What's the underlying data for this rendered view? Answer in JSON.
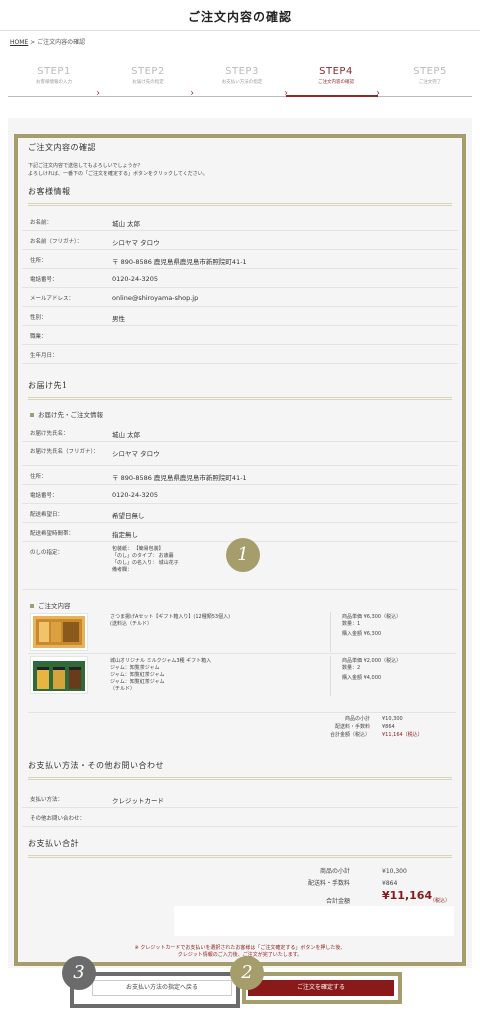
{
  "page_title": "ご注文内容の確認",
  "breadcrumb": {
    "home": "HOME",
    "sep": ">",
    "current": "ご注文内容の確認"
  },
  "steps": [
    {
      "num": "STEP1",
      "label": "お客様情報の入力"
    },
    {
      "num": "STEP2",
      "label": "お届け先の指定"
    },
    {
      "num": "STEP3",
      "label": "お支払い方法の指定"
    },
    {
      "num": "STEP4",
      "label": "ご注文内容の確認"
    },
    {
      "num": "STEP5",
      "label": "ご注文完了"
    }
  ],
  "confirm": {
    "heading": "ご注文内容の確認",
    "intro1": "下記ご注文内容で送信してもよろしいでしょうか？",
    "intro2": "よろしければ、一番下の「ご注文を確定する」ボタンをクリックしてください。"
  },
  "customer": {
    "heading": "お客様情報",
    "rows": [
      {
        "k": "お名前：",
        "v": "城山 太郎"
      },
      {
        "k": "お名前（フリガナ）：",
        "v": "シロヤマ タロウ"
      },
      {
        "k": "住所：",
        "v": "〒 890-8586 鹿児島県鹿児島市新照院町41-1"
      },
      {
        "k": "電話番号：",
        "v": "0120-24-3205"
      },
      {
        "k": "メールアドレス：",
        "v": "online@shiroyama-shop.jp"
      },
      {
        "k": "性別：",
        "v": "男性"
      },
      {
        "k": "職業：",
        "v": ""
      },
      {
        "k": "生年月日：",
        "v": ""
      }
    ]
  },
  "delivery": {
    "heading": "お届け先1",
    "sub": "お届け先・ご注文情報",
    "rows": [
      {
        "k": "お届け先氏名：",
        "v": "城山 太郎"
      },
      {
        "k": "お届け先氏名（フリガナ）：",
        "v": "シロヤマ タロウ"
      },
      {
        "k": "住所：",
        "v": "〒 890-8586 鹿児島県鹿児島市新照院町41-1"
      },
      {
        "k": "電話番号：",
        "v": "0120-24-3205"
      },
      {
        "k": "配送希望日：",
        "v": "希望日無し"
      },
      {
        "k": "配送希望時間帯：",
        "v": "指定無し"
      }
    ],
    "noshi_key": "のしの指定：",
    "noshi_lines": [
      "包装紙： 【簡易包装】",
      "「のし」のタイプ： お歳暮",
      "「のし」の名入り： 城山花子",
      "備考欄："
    ]
  },
  "order": {
    "sub": "ご注文内容",
    "items": [
      {
        "name": "さつま揚げAセット【ギフト箱入り】(12種類53個入)",
        "note": "(送料込（チルド）",
        "price": "商品単価 ¥6,300（税込）",
        "qty": "数量：1",
        "amount": "購入金額 ¥6,300"
      },
      {
        "name": "城山オリジナル ミルクジャム3種 ギフト箱入",
        "note1": "ジャム：知覧茶ジャム",
        "note2": "ジャム：知覧紅茶ジャム",
        "note3": "ジャム：知覧紅茶ジャム",
        "note4": "（チルド）",
        "price": "商品単価 ¥2,000（税込）",
        "qty": "数量：2",
        "amount": "購入金額 ¥4,000"
      }
    ],
    "subtotal_label": "商品の小計",
    "subtotal": "¥10,300",
    "shipping_label": "配送料・手数料",
    "shipping": "¥864",
    "total_label": "合計金額（税込）",
    "total": "¥11,164（税込）"
  },
  "payment": {
    "heading": "お支払い方法・その他お問い合わせ",
    "rows": [
      {
        "k": "支払い方法：",
        "v": "クレジットカード"
      },
      {
        "k": "その他お問い合わせ：",
        "v": ""
      }
    ]
  },
  "payment_total": {
    "heading": "お支払い合計",
    "subtotal_label": "商品の小計",
    "subtotal": "¥10,300",
    "shipping_label": "配送料・手数料",
    "shipping": "¥864",
    "total_label": "合計金額",
    "total": "¥11,164",
    "tax": "（税込）"
  },
  "notice1": "※ クレジットカードでお支払いを選択されたお客様は「ご注文確定する」ボタンを押した後、",
  "notice2": "クレジット情報のご入力後、ご注文が完了いたします。",
  "buttons": {
    "back": "お支払い方法の指定へ戻る",
    "confirm": "ご注文を確定する"
  },
  "badges": [
    "1",
    "2",
    "3"
  ],
  "colors": {
    "accent": "#8a1a1a",
    "gold": "#a59e6c",
    "gray": "#6b6b6b"
  }
}
